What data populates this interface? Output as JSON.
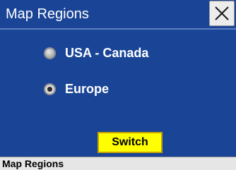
{
  "window": {
    "title": "Map Regions",
    "close_icon": "close-icon"
  },
  "regions": {
    "options": [
      {
        "label": "USA - Canada",
        "selected": false
      },
      {
        "label": "Europe",
        "selected": true
      }
    ]
  },
  "actions": {
    "switch_label": "Switch"
  },
  "status_bar": {
    "text": "Map Regions"
  },
  "colors": {
    "background": "#1a4597",
    "button": "#ffff00",
    "status_bar": "#e6e6e6"
  }
}
